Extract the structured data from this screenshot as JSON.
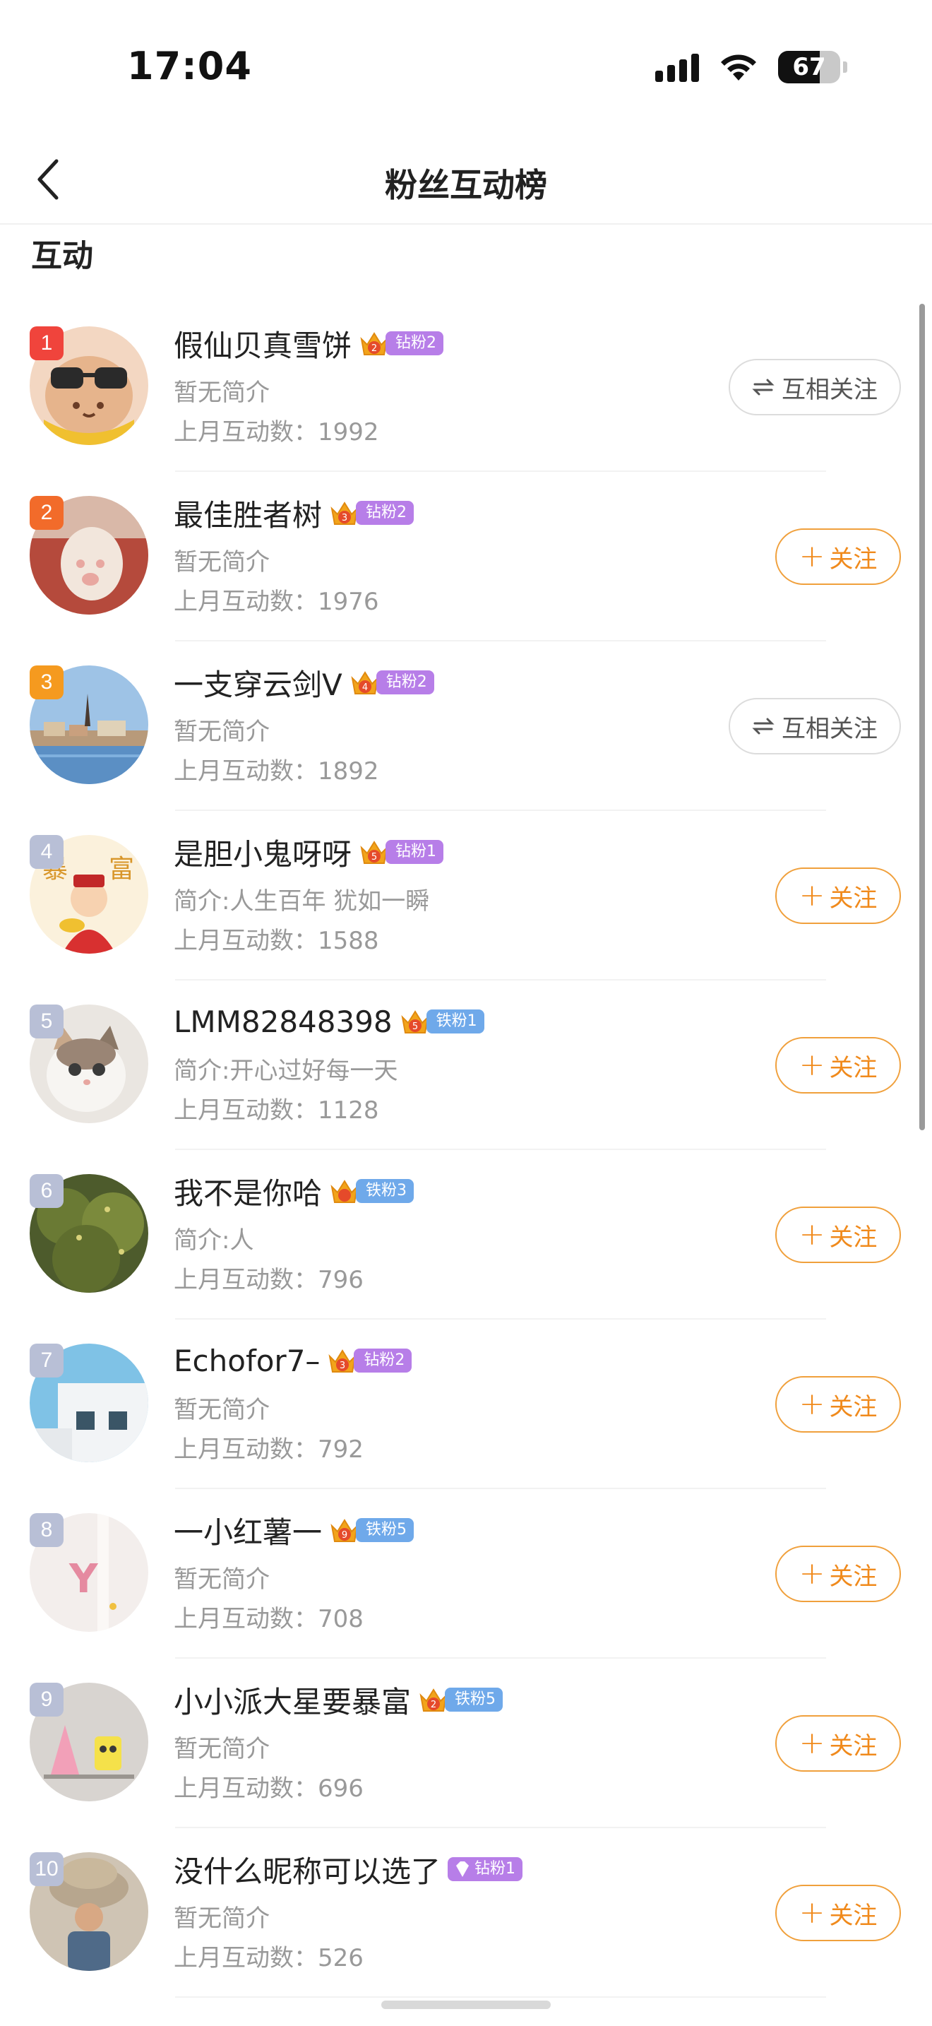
{
  "status_bar": {
    "time": "17:04",
    "battery": "67",
    "battery_level": 0.67
  },
  "nav": {
    "title": "粉丝互动榜"
  },
  "section": {
    "title": "互动"
  },
  "users": [
    {
      "rank": "1",
      "name": "假仙贝真雪饼",
      "badge_level": "2",
      "badge_label": "钻粉2",
      "badge_type": "diamond",
      "bio": "暂无简介",
      "count": "上月互动数：1992",
      "action": "mutual",
      "action_label": "互相关注"
    },
    {
      "rank": "2",
      "name": "最佳胜者树",
      "badge_level": "3",
      "badge_label": "钻粉2",
      "badge_type": "diamond",
      "bio": "暂无简介",
      "count": "上月互动数：1976",
      "action": "follow",
      "action_label": "关注"
    },
    {
      "rank": "3",
      "name": "一支穿云剑V",
      "badge_level": "4",
      "badge_label": "钻粉2",
      "badge_type": "diamond",
      "bio": "暂无简介",
      "count": "上月互动数：1892",
      "action": "mutual",
      "action_label": "互相关注"
    },
    {
      "rank": "4",
      "name": "是胆小鬼呀呀",
      "badge_level": "5",
      "badge_label": "钻粉1",
      "badge_type": "diamond",
      "bio": "简介:人生百年 犹如一瞬",
      "count": "上月互动数：1588",
      "action": "follow",
      "action_label": "关注"
    },
    {
      "rank": "5",
      "name": "LMM82848398",
      "badge_level": "5",
      "badge_label": "铁粉1",
      "badge_type": "iron",
      "bio": "简介:开心过好每一天",
      "count": "上月互动数：1128",
      "action": "follow",
      "action_label": "关注"
    },
    {
      "rank": "6",
      "name": "我不是你哈",
      "badge_level": "",
      "badge_label": "铁粉3",
      "badge_type": "iron",
      "bio": "简介:人",
      "count": "上月互动数：796",
      "action": "follow",
      "action_label": "关注"
    },
    {
      "rank": "7",
      "name": "Echofor7–",
      "badge_level": "3",
      "badge_label": "钻粉2",
      "badge_type": "diamond",
      "bio": "暂无简介",
      "count": "上月互动数：792",
      "action": "follow",
      "action_label": "关注"
    },
    {
      "rank": "8",
      "name": "一小红薯一",
      "badge_level": "9",
      "badge_label": "铁粉5",
      "badge_type": "iron",
      "bio": "暂无简介",
      "count": "上月互动数：708",
      "action": "follow",
      "action_label": "关注"
    },
    {
      "rank": "9",
      "name": "小小派大星要暴富",
      "badge_level": "2",
      "badge_label": "铁粉5",
      "badge_type": "iron",
      "bio": "暂无简介",
      "count": "上月互动数：696",
      "action": "follow",
      "action_label": "关注"
    },
    {
      "rank": "10",
      "name": "没什么昵称可以选了",
      "badge_level": "",
      "badge_label": "钻粉1",
      "badge_type": "gem",
      "bio": "暂无简介",
      "count": "上月互动数：526",
      "action": "follow",
      "action_label": "关注"
    }
  ],
  "colors": {
    "rank1": "#f0443c",
    "rank2": "#f26b2a",
    "rank3": "#f59a1f",
    "rank_other": "#b8bfd6",
    "diamond_badge": "#b77ee8",
    "iron_badge": "#6fa9ea",
    "follow": "#f08a1c"
  },
  "avatars": [
    "sunglasses-bun",
    "cat-paw-on-sofa",
    "city-waterfront",
    "fortune-god-baozhu",
    "white-kitten",
    "green-tree",
    "building-corner",
    "letter-y-pink",
    "patrick-spongebob",
    "person-carrying-sacks"
  ]
}
